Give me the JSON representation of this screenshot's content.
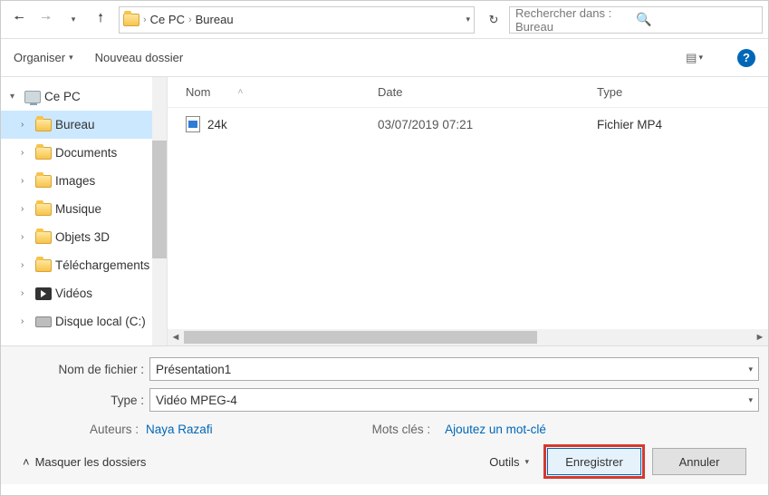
{
  "nav": {
    "breadcrumb": [
      "Ce PC",
      "Bureau"
    ],
    "search_placeholder": "Rechercher dans : Bureau"
  },
  "toolbar": {
    "organize": "Organiser",
    "new_folder": "Nouveau dossier"
  },
  "tree": {
    "root": "Ce PC",
    "items": [
      {
        "label": "Bureau",
        "icon": "folder",
        "selected": true
      },
      {
        "label": "Documents",
        "icon": "folder"
      },
      {
        "label": "Images",
        "icon": "folder"
      },
      {
        "label": "Musique",
        "icon": "folder"
      },
      {
        "label": "Objets 3D",
        "icon": "folder"
      },
      {
        "label": "Téléchargements",
        "icon": "folder"
      },
      {
        "label": "Vidéos",
        "icon": "video"
      },
      {
        "label": "Disque local (C:)",
        "icon": "drive"
      }
    ]
  },
  "columns": {
    "name": "Nom",
    "date": "Date",
    "type": "Type"
  },
  "files": [
    {
      "name": "24k",
      "date": "03/07/2019 07:21",
      "type": "Fichier MP4"
    }
  ],
  "form": {
    "filename_label": "Nom de fichier :",
    "filename_value": "Présentation1",
    "type_label": "Type :",
    "type_value": "Vidéo MPEG-4",
    "authors_label": "Auteurs :",
    "authors_value": "Naya Razafi",
    "tags_label": "Mots clés :",
    "tags_value": "Ajoutez un mot-clé"
  },
  "footer": {
    "hide_folders": "Masquer les dossiers",
    "tools": "Outils",
    "save": "Enregistrer",
    "cancel": "Annuler"
  }
}
